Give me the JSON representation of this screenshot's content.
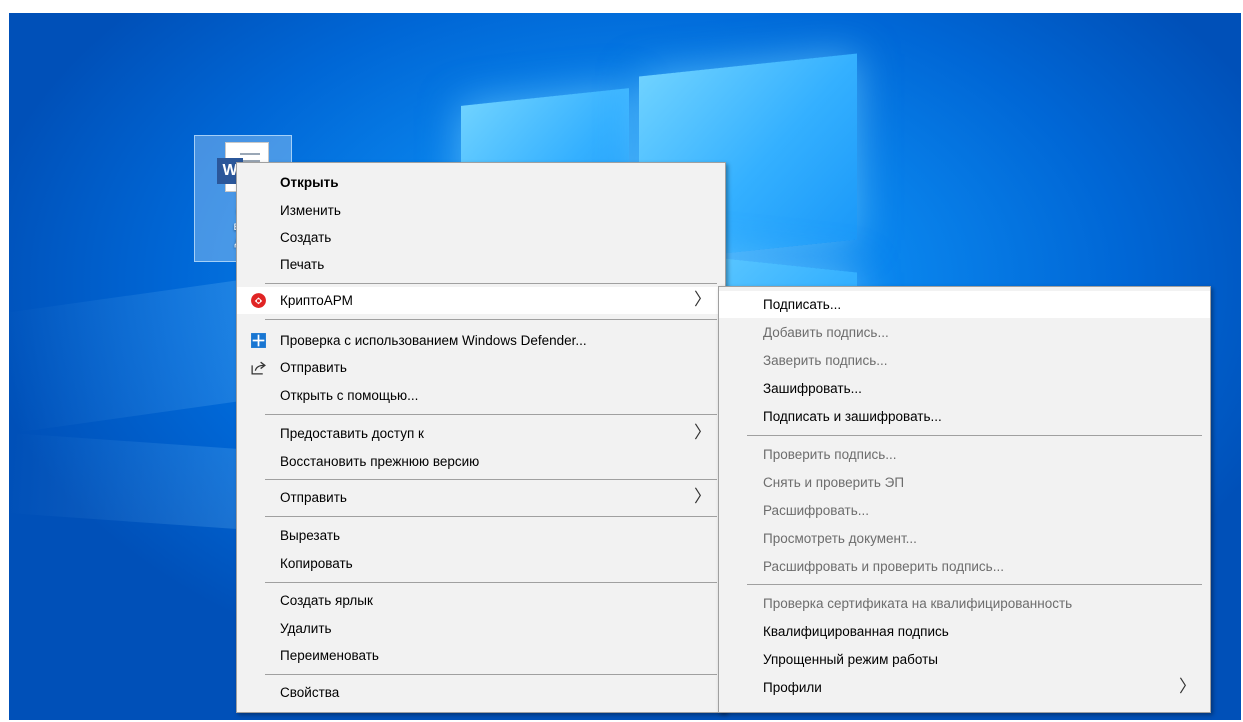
{
  "desktop": {
    "icon_label": "Оч\nваж\nдок",
    "icon_badge": "W"
  },
  "main_menu": {
    "items": [
      {
        "label": "Открыть",
        "bold": true
      },
      {
        "label": "Изменить"
      },
      {
        "label": "Создать"
      },
      {
        "label": "Печать"
      },
      {
        "label": "КриптоАРМ",
        "submenu": true,
        "icon": "cryptoarm-icon"
      },
      {
        "label": "Проверка с использованием Windows Defender...",
        "icon": "windows-defender-icon"
      },
      {
        "label": "Отправить",
        "icon": "share-icon"
      },
      {
        "label": "Открыть с помощью..."
      },
      {
        "label": "Предоставить доступ к",
        "submenu": true
      },
      {
        "label": "Восстановить прежнюю версию"
      },
      {
        "label": "Отправить",
        "submenu": true
      },
      {
        "label": "Вырезать"
      },
      {
        "label": "Копировать"
      },
      {
        "label": "Создать ярлык"
      },
      {
        "label": "Удалить"
      },
      {
        "label": "Переименовать"
      },
      {
        "label": "Свойства"
      }
    ],
    "chevron": "〉"
  },
  "sub_menu": {
    "items": [
      {
        "label": "Подписать..."
      },
      {
        "label": "Добавить подпись...",
        "disabled": true
      },
      {
        "label": "Заверить подпись...",
        "disabled": true
      },
      {
        "label": "Зашифровать..."
      },
      {
        "label": "Подписать и зашифровать..."
      },
      {
        "label": "Проверить подпись...",
        "disabled": true
      },
      {
        "label": "Снять и проверить ЭП",
        "disabled": true
      },
      {
        "label": "Расшифровать...",
        "disabled": true
      },
      {
        "label": "Просмотреть документ...",
        "disabled": true
      },
      {
        "label": "Расшифровать и проверить подпись...",
        "disabled": true
      },
      {
        "label": "Проверка сертификата на квалифицированность",
        "disabled": true
      },
      {
        "label": "Квалифицированная подпись"
      },
      {
        "label": "Упрощенный режим работы"
      },
      {
        "label": "Профили",
        "submenu": true
      }
    ]
  },
  "colors": {
    "menu_bg": "#f2f2f2",
    "highlight": "#ffffff",
    "disabled_text": "#6d6d6d",
    "cryptoarm_red": "#e02424",
    "defender_blue": "#1976d2"
  }
}
